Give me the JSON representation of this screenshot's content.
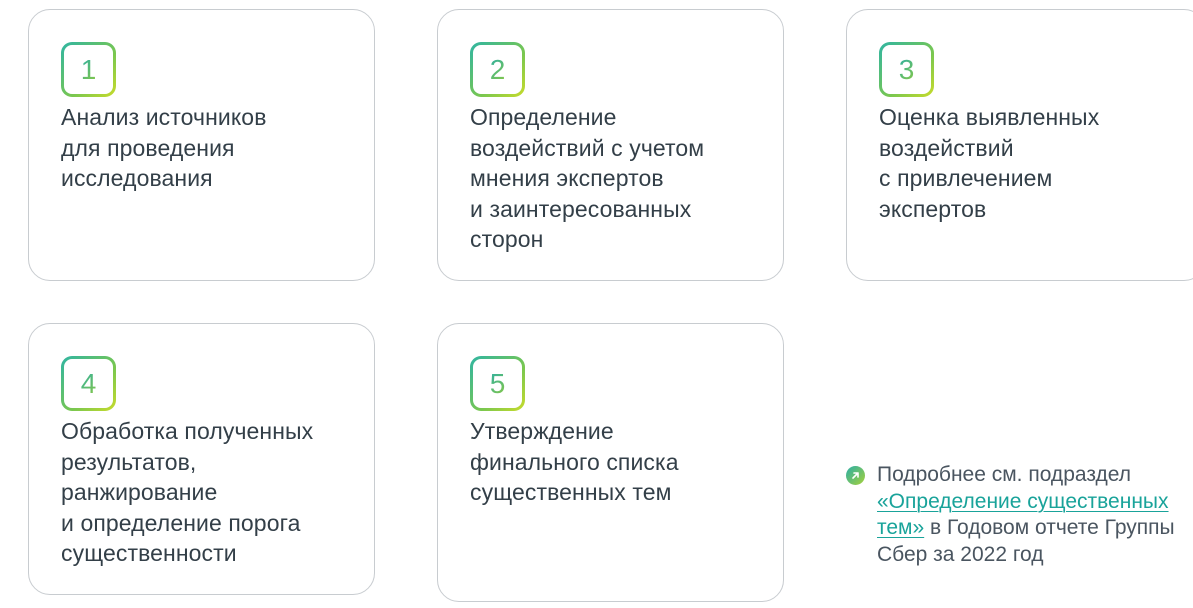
{
  "steps": [
    {
      "number": "1",
      "title": "Анализ источников\nдля проведения\nисследования"
    },
    {
      "number": "2",
      "title": "Определение\nвоздействий с учетом\nмнения экспертов\nи заинтересованных\nсторон"
    },
    {
      "number": "3",
      "title": "Оценка выявленных\nвоздействий\nс привлечением\nэкспертов"
    },
    {
      "number": "4",
      "title": "Обработка полученных\nрезультатов,\nранжирование\nи определение порога\nсущественности"
    },
    {
      "number": "5",
      "title": "Утверждение\nфинального списка\nсущественных тем"
    }
  ],
  "note": {
    "icon": "arrow-up-right-icon",
    "prefix": "Подробнее см. подраздел ",
    "link_text": "«Определение существенных тем»",
    "suffix": " в Годовом отчете Группы Сбер за 2022 год"
  },
  "colors": {
    "gradient_start": "#2aaea6",
    "gradient_end": "#c9dc2a",
    "text": "#333f48",
    "link": "#19a39a",
    "card_border": "#c8ccd0"
  }
}
